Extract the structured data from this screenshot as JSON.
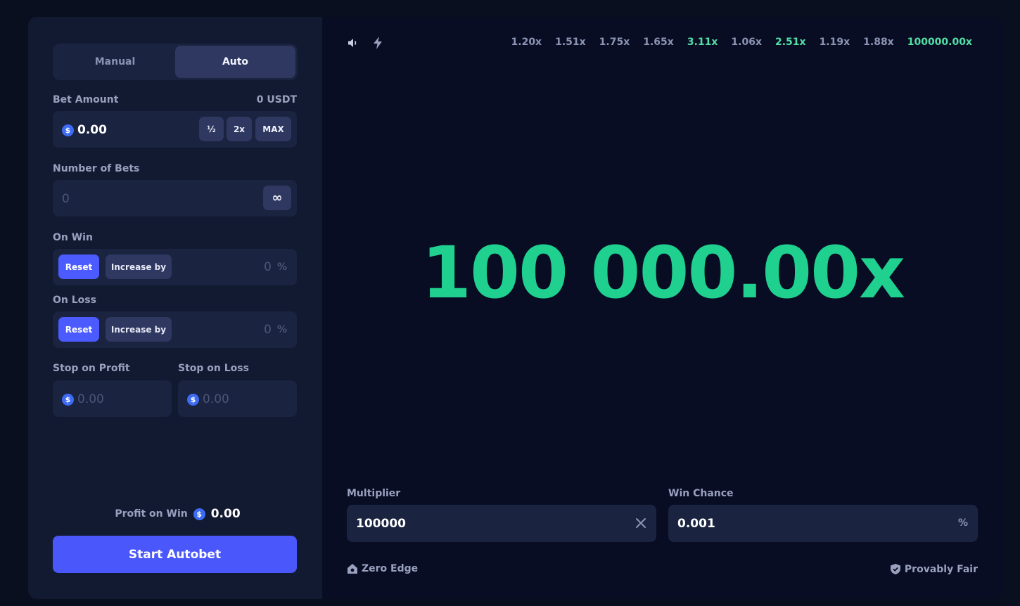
{
  "tabs": [
    {
      "label": "Manual",
      "active": false
    },
    {
      "label": "Auto",
      "active": true
    }
  ],
  "bet_amount": {
    "label": "Bet Amount",
    "balance": "0 USDT",
    "value": "0.00",
    "half_label": "½",
    "double_label": "2x",
    "max_label": "MAX"
  },
  "number_of_bets": {
    "label": "Number of Bets",
    "placeholder": "0",
    "infinity_symbol": "∞"
  },
  "on_win": {
    "label": "On Win",
    "reset_label": "Reset",
    "increase_label": "Increase by",
    "value": "0",
    "unit": "%"
  },
  "on_loss": {
    "label": "On Loss",
    "reset_label": "Reset",
    "increase_label": "Increase by",
    "value": "0",
    "unit": "%"
  },
  "stop_on_profit": {
    "label": "Stop on Profit",
    "value": "0.00"
  },
  "stop_on_loss": {
    "label": "Stop on Loss",
    "value": "0.00"
  },
  "profit_on_win": {
    "label": "Profit on Win",
    "value": "0.00"
  },
  "start_button": "Start Autobet",
  "coin_symbol": "$",
  "history": [
    {
      "value": "1.20x",
      "win": false
    },
    {
      "value": "1.51x",
      "win": false
    },
    {
      "value": "1.75x",
      "win": false
    },
    {
      "value": "1.65x",
      "win": false
    },
    {
      "value": "3.11x",
      "win": true
    },
    {
      "value": "1.06x",
      "win": false
    },
    {
      "value": "2.51x",
      "win": true
    },
    {
      "value": "1.19x",
      "win": false
    },
    {
      "value": "1.88x",
      "win": false
    },
    {
      "value": "100000.00x",
      "win": true
    }
  ],
  "result_display": "100 000.00x",
  "multiplier": {
    "label": "Multiplier",
    "value": "100000"
  },
  "win_chance": {
    "label": "Win Chance",
    "value": "0.001",
    "unit": "%"
  },
  "footer": {
    "zero_edge": "Zero Edge",
    "provably_fair": "Provably Fair"
  },
  "colors": {
    "accent": "#4a57fb",
    "win_green": "#1fd08f",
    "panel": "#121a31",
    "background": "#080d23"
  }
}
